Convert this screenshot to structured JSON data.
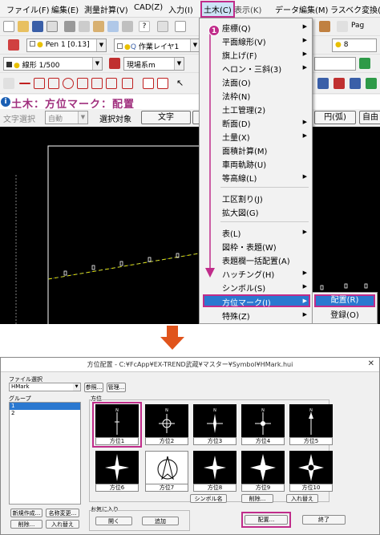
{
  "menubar": {
    "items": [
      "ファイル(F)",
      "編集(E)",
      "測量計算(V)",
      "CAD(Z)",
      "入力(I)",
      "土木(C)",
      "表示(K)",
      "データ編集(M)",
      "ラスベク変換(E)"
    ]
  },
  "toolbar": {
    "pen_combo": "Pen 1 [0.13]",
    "layer_combo": "作業レイヤ1",
    "size_combo": "8",
    "line_combo": "線形 1/500",
    "coord_combo": "現場系m",
    "page_label": "Pag"
  },
  "command": {
    "title": "土木：方位マーク：配置"
  },
  "options": {
    "text_select_label": "文字選択",
    "text_select_value": "自動",
    "target_label": "選択対象",
    "text_button": "文字",
    "arc_button": "円(弧)",
    "free_button": "自由"
  },
  "dropdown": {
    "items": [
      "座標(Q)",
      "平面線形(V)",
      "旗上げ(F)",
      "ヘロン・三斜(3)",
      "法面(O)",
      "法枠(N)",
      "土工管理(2)",
      "断面(D)",
      "土量(X)",
      "面積計算(M)",
      "車両軌跡(U)",
      "等高線(L)",
      "工区割り(J)",
      "拡大図(G)",
      "表(L)",
      "図枠・表題(W)",
      "表題欄一括配置(A)",
      "ハッチング(H)",
      "シンボル(S)",
      "方位マーク(I)",
      "特殊(Z)"
    ],
    "highlighted": "方位マーク(I)",
    "submenu": {
      "place": "配置(R)",
      "register": "登録(O)"
    }
  },
  "marker_number": "1",
  "dialog": {
    "title": "方位配置 - C:¥FcApp¥EX-TREND武蔵¥マスター¥Symbol¥HMark.hui",
    "file_select_label": "ファイル選択",
    "file_value": "HMark",
    "browse_button": "参照...",
    "manage_button": "管理...",
    "group_label": "グループ",
    "groups": [
      "1",
      "2"
    ],
    "direction_label": "方位",
    "marks": [
      "方位1",
      "方位2",
      "方位3",
      "方位4",
      "方位5",
      "方位6",
      "方位7",
      "方位8",
      "方位9",
      "方位10"
    ],
    "symbol_name_button": "シンボル名",
    "delete_button": "削除...",
    "reorder_button": "入れ替え",
    "new_button": "新規作成...",
    "rename_button": "名称変更...",
    "group_delete_button": "削除...",
    "group_reorder_button": "入れ替え",
    "favorites_label": "お気に入り",
    "open_button": "開く",
    "add_button": "追加",
    "place_button": "配置...",
    "close_button": "終了"
  },
  "colors": {
    "accent": "#c02c8a",
    "highlight": "#2a78d0",
    "arrow": "#e0541c"
  }
}
